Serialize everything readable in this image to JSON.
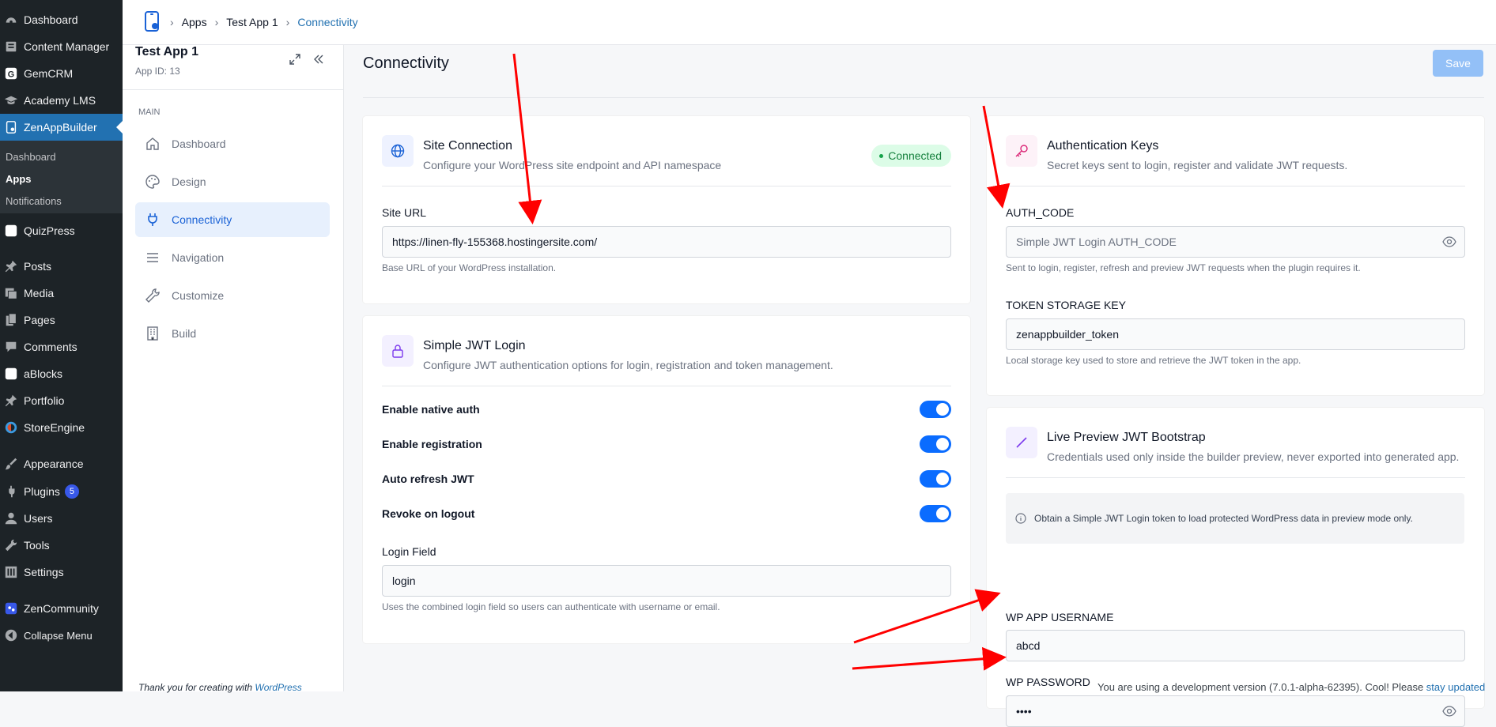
{
  "wp_menu": {
    "items": [
      {
        "label": "Dashboard",
        "icon": "dashboard-icon"
      },
      {
        "label": "Content Manager",
        "icon": "content-manager-icon"
      },
      {
        "label": "GemCRM",
        "icon": "gemcrm-icon"
      },
      {
        "label": "Academy LMS",
        "icon": "academy-icon"
      },
      {
        "label": "ZenAppBuilder",
        "icon": "zenappbuilder-icon"
      },
      {
        "label": "QuizPress",
        "icon": "quizpress-icon"
      },
      {
        "label": "Posts",
        "icon": "pin-icon"
      },
      {
        "label": "Media",
        "icon": "media-icon"
      },
      {
        "label": "Pages",
        "icon": "pages-icon"
      },
      {
        "label": "Comments",
        "icon": "comments-icon"
      },
      {
        "label": "aBlocks",
        "icon": "ablocks-icon"
      },
      {
        "label": "Portfolio",
        "icon": "pin-icon"
      },
      {
        "label": "StoreEngine",
        "icon": "storeengine-icon"
      },
      {
        "label": "Appearance",
        "icon": "brush-icon"
      },
      {
        "label": "Plugins",
        "icon": "plugin-icon",
        "badge": "5"
      },
      {
        "label": "Users",
        "icon": "users-icon"
      },
      {
        "label": "Tools",
        "icon": "wrench-icon"
      },
      {
        "label": "Settings",
        "icon": "settings-icon"
      },
      {
        "label": "ZenCommunity",
        "icon": "zencommunity-icon"
      },
      {
        "label": "Collapse Menu",
        "icon": "collapse-icon"
      }
    ],
    "submenu": [
      "Dashboard",
      "Apps",
      "Notifications"
    ]
  },
  "breadcrumb": [
    "Apps",
    "Test App 1",
    "Connectivity"
  ],
  "side_panel": {
    "app_name": "Test App 1",
    "app_id": "App ID: 13",
    "section": "MAIN",
    "nav": [
      "Dashboard",
      "Design",
      "Connectivity",
      "Navigation",
      "Customize",
      "Build"
    ],
    "footer_text": "Thank you for creating with ",
    "footer_link": "WordPress"
  },
  "main": {
    "title": "Connectivity",
    "save_label": "Save",
    "site_connection": {
      "title": "Site Connection",
      "desc": "Configure your WordPress site endpoint and API namespace",
      "status": "Connected",
      "site_url_label": "Site URL",
      "site_url_value": "https://linen-fly-155368.hostingersite.com/",
      "site_url_help": "Base URL of your WordPress installation."
    },
    "jwt": {
      "title": "Simple JWT Login",
      "desc": "Configure JWT authentication options for login, registration and token management.",
      "toggles": [
        "Enable native auth",
        "Enable registration",
        "Auto refresh JWT",
        "Revoke on logout"
      ],
      "login_field_label": "Login Field",
      "login_field_value": "login",
      "login_field_help": "Uses the combined login field so users can authenticate with username or email."
    },
    "auth_keys": {
      "title": "Authentication Keys",
      "desc": "Secret keys sent to login, register and validate JWT requests.",
      "auth_code_label": "AUTH_CODE",
      "auth_code_placeholder": "Simple JWT Login AUTH_CODE",
      "auth_code_help": "Sent to login, register, refresh and preview JWT requests when the plugin requires it.",
      "token_key_label": "TOKEN STORAGE KEY",
      "token_key_value": "zenappbuilder_token",
      "token_key_help": "Local storage key used to store and retrieve the JWT token in the app."
    },
    "preview": {
      "title": "Live Preview JWT Bootstrap",
      "desc": "Credentials used only inside the builder preview, never exported into generated app.",
      "info": "Obtain a Simple JWT Login token to load protected WordPress data in preview mode only.",
      "username_label": "WP APP USERNAME",
      "username_value": "abcd",
      "password_label": "WP PASSWORD",
      "password_value": "••••"
    }
  },
  "dev_notice": {
    "text": "You are using a development version (7.0.1-alpha-62395). Cool! Please ",
    "link": "stay updated"
  }
}
